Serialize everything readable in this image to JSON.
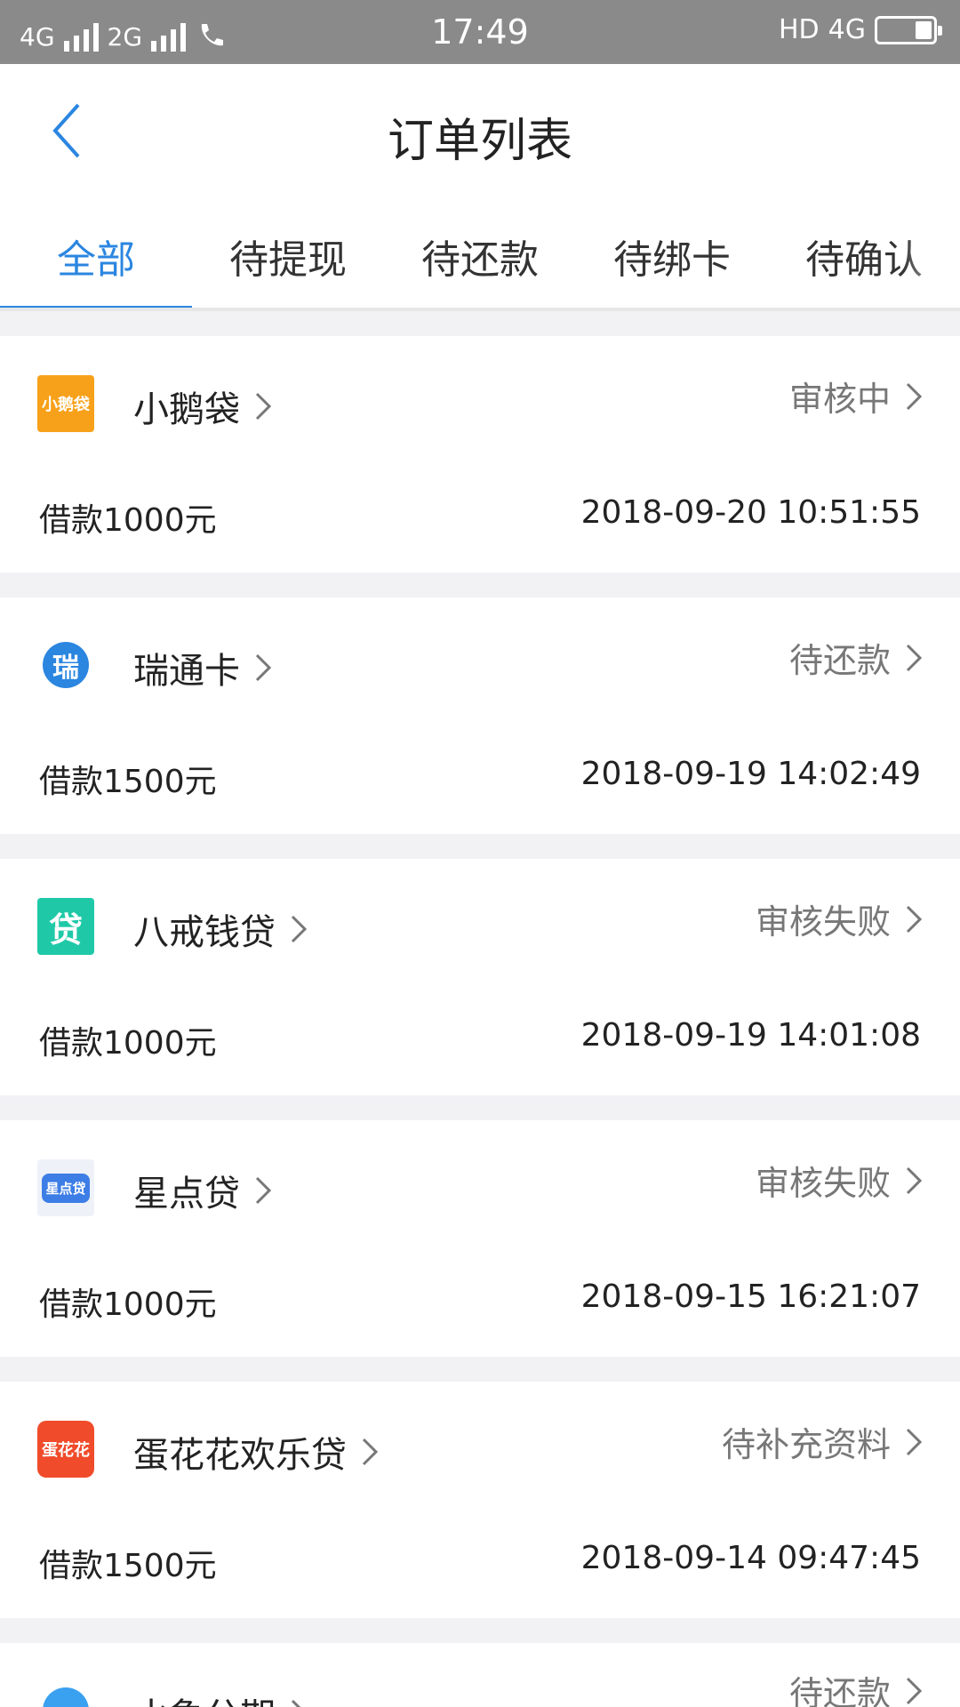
{
  "status_bar": {
    "net1": "4G",
    "net2": "2G",
    "time": "17:49",
    "hd": "HD",
    "net3": "4G"
  },
  "header": {
    "title": "订单列表"
  },
  "tabs": [
    {
      "label": "全部",
      "active": true
    },
    {
      "label": "待提现",
      "active": false
    },
    {
      "label": "待还款",
      "active": false
    },
    {
      "label": "待绑卡",
      "active": false
    },
    {
      "label": "待确认",
      "active": false
    }
  ],
  "colors": {
    "accent": "#2b86e0",
    "status_text": "#777777"
  },
  "orders": [
    {
      "name": "小鹅袋",
      "status": "审核中",
      "amount": "借款1000元",
      "date": "2018-09-20 10:51:55",
      "logo_text": "小鹅袋",
      "logo_icon": "xiaoedai-logo-icon"
    },
    {
      "name": "瑞通卡",
      "status": "待还款",
      "amount": "借款1500元",
      "date": "2018-09-19 14:02:49",
      "logo_text": "瑞",
      "logo_icon": "ruitongka-logo-icon"
    },
    {
      "name": "八戒钱贷",
      "status": "审核失败",
      "amount": "借款1000元",
      "date": "2018-09-19 14:01:08",
      "logo_text": "贷",
      "logo_icon": "bajieqiandai-logo-icon"
    },
    {
      "name": "星点贷",
      "status": "审核失败",
      "amount": "借款1000元",
      "date": "2018-09-15 16:21:07",
      "logo_text": "星点贷",
      "logo_icon": "xingdiandai-logo-icon"
    },
    {
      "name": "蛋花花欢乐贷",
      "status": "待补充资料",
      "amount": "借款1500元",
      "date": "2018-09-14 09:47:45",
      "logo_text": "蛋花花",
      "logo_icon": "danhuahua-logo-icon"
    },
    {
      "name": "水象分期",
      "status": "待还款",
      "amount": "",
      "date": "",
      "logo_text": "",
      "logo_icon": "shuixiang-logo-icon"
    }
  ]
}
